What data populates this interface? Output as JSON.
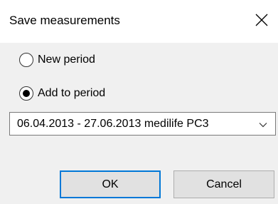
{
  "window": {
    "title": "Save measurements",
    "close_icon": "close-x-icon"
  },
  "options": {
    "new_period": {
      "label": "New period",
      "selected": false
    },
    "add_to_period": {
      "label": "Add to period",
      "selected": true
    }
  },
  "period_select": {
    "value": "06.04.2013 - 27.06.2013 medilife PC3",
    "icon": "chevron-down-icon"
  },
  "buttons": {
    "ok_label": "OK",
    "cancel_label": "Cancel"
  },
  "colors": {
    "accent": "#0078d7",
    "dialog_background": "#f0f0f0",
    "titlebar_background": "#ffffff"
  }
}
